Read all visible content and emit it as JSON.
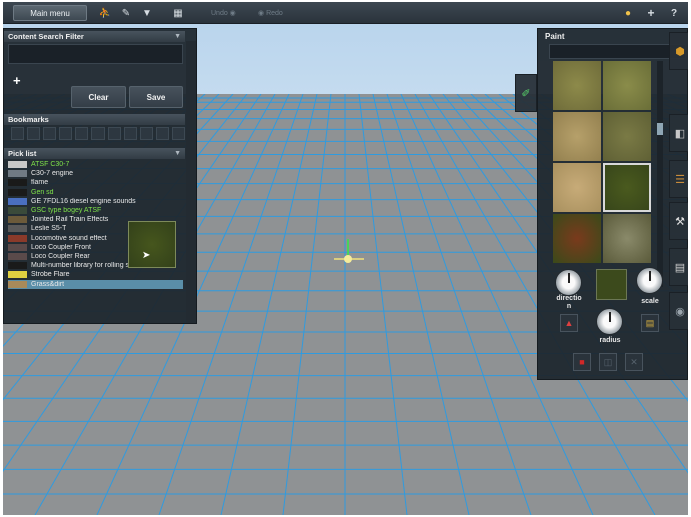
{
  "toolbar": {
    "main_menu": "Main menu",
    "undo_label": "Undo",
    "redo_label": "Redo",
    "icons": [
      "person-icon",
      "edit-icon",
      "filter-icon",
      "grid-icon"
    ],
    "right_icons": [
      "lightbulb-icon",
      "plus-icon",
      "help-icon"
    ],
    "help_glyph": "?"
  },
  "left_panel": {
    "search_header": "Content Search Filter",
    "clear_label": "Clear",
    "save_label": "Save",
    "bookmarks_header": "Bookmarks",
    "picklist_header": "Pick list",
    "picklist": [
      {
        "label": "ATSF C30-7",
        "color": "green"
      },
      {
        "label": "C30-7 engine",
        "color": "white"
      },
      {
        "label": "flame",
        "color": "white"
      },
      {
        "label": "Gen sd",
        "color": "green"
      },
      {
        "label": "GE 7FDL16 diesel engine sounds",
        "color": "white"
      },
      {
        "label": "GSC type bogey ATSF",
        "color": "green"
      },
      {
        "label": "Jointed Rail Train Effects",
        "color": "white"
      },
      {
        "label": "Leslie S5-T",
        "color": "white"
      },
      {
        "label": "Locomotive sound effect",
        "color": "white"
      },
      {
        "label": "Loco Coupler Front",
        "color": "white"
      },
      {
        "label": "Loco Coupler Rear",
        "color": "white"
      },
      {
        "label": "Multi-number library for rolling sto...",
        "color": "white"
      },
      {
        "label": "Strobe Flare",
        "color": "white"
      },
      {
        "label": "Grass&dirt",
        "color": "white"
      }
    ],
    "selected_index": 13
  },
  "paint_panel": {
    "header": "Paint",
    "direction_label": "directio\nn",
    "scale_label": "scale",
    "radius_label": "radius",
    "selected_texture_index": 5
  },
  "colors": {
    "grid_line": "#2f9be0",
    "ground": "#8f9294",
    "sky": "#bcd6ee",
    "accent_green": "#7ee24a",
    "selected_row": "#5a8ea8"
  }
}
